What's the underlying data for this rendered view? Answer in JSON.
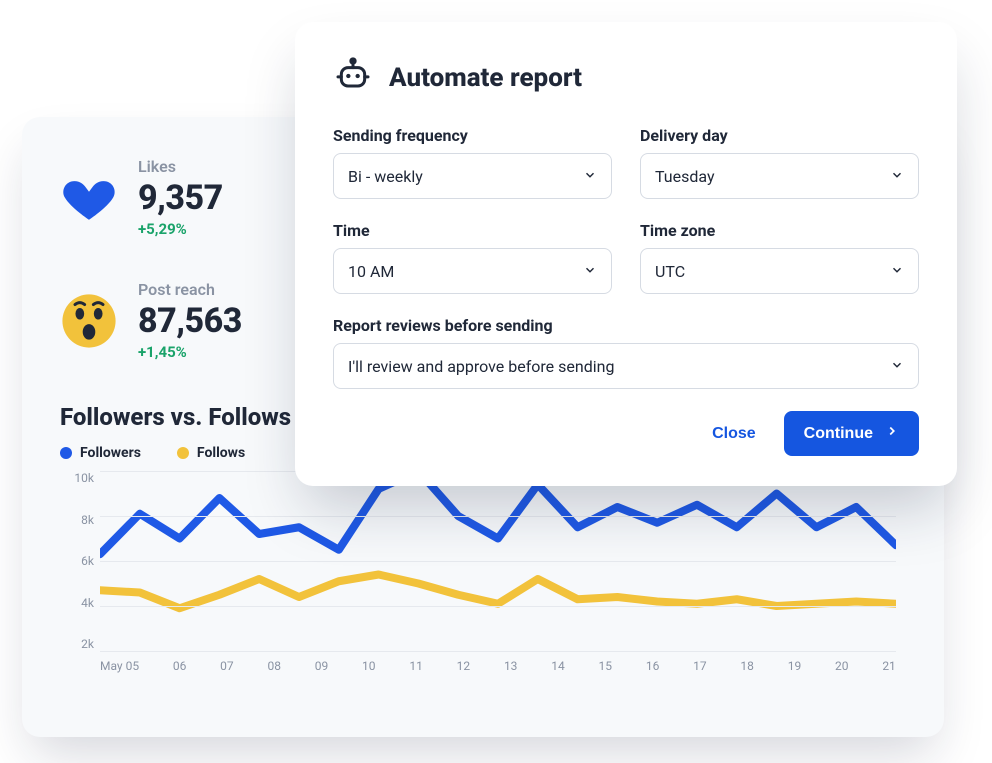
{
  "stats": {
    "likes": {
      "label": "Likes",
      "value": "9,357",
      "delta": "+5,29%"
    },
    "post_reach": {
      "label": "Post reach",
      "value": "87,563",
      "delta": "+1,45%"
    }
  },
  "chart": {
    "title": "Followers vs. Follows",
    "legend": {
      "followers": "Followers",
      "follows": "Follows"
    }
  },
  "chart_data": {
    "type": "line",
    "categories": [
      "May 05",
      "06",
      "07",
      "08",
      "09",
      "10",
      "11",
      "12",
      "13",
      "14",
      "15",
      "16",
      "17",
      "18",
      "19",
      "20",
      "21"
    ],
    "series": [
      {
        "name": "Followers",
        "color": "#1f59e6",
        "values": [
          6300,
          8100,
          7000,
          8800,
          7200,
          7500,
          6500,
          9200,
          10000,
          8000,
          7000,
          9400,
          7500,
          8400,
          7700,
          8500,
          7500,
          9000,
          7500,
          8400,
          6700
        ]
      },
      {
        "name": "Follows",
        "color": "#f2c23b",
        "values": [
          4700,
          4600,
          3900,
          4500,
          5200,
          4400,
          5100,
          5400,
          5000,
          4500,
          4100,
          5200,
          4300,
          4400,
          4200,
          4100,
          4300,
          4000,
          4100,
          4200,
          4100
        ]
      }
    ],
    "ylim": [
      2000,
      10000
    ],
    "y_ticks": [
      "10k",
      "8k",
      "6k",
      "4k",
      "2k"
    ]
  },
  "modal": {
    "title": "Automate report",
    "fields": {
      "frequency": {
        "label": "Sending frequency",
        "value": "Bi - weekly"
      },
      "day": {
        "label": "Delivery day",
        "value": "Tuesday"
      },
      "time": {
        "label": "Time",
        "value": "10 AM"
      },
      "tz": {
        "label": "Time zone",
        "value": "UTC"
      },
      "review": {
        "label": "Report reviews before sending",
        "value": "I'll review and approve before sending"
      }
    },
    "buttons": {
      "close": "Close",
      "continue": "Continue"
    }
  },
  "colors": {
    "primary": "#1556e0",
    "success": "#1aa36a",
    "followers": "#1f59e6",
    "follows": "#f2c23b"
  }
}
